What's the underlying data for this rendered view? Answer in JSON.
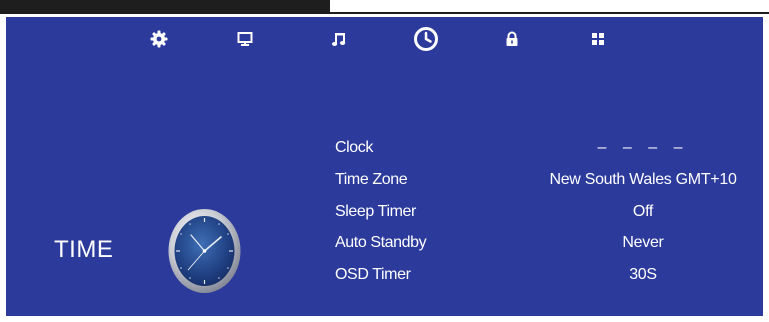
{
  "menu": {
    "items": [
      {
        "id": "settings",
        "icon": "gear-icon"
      },
      {
        "id": "picture",
        "icon": "monitor-icon"
      },
      {
        "id": "sound",
        "icon": "music-note-icon"
      },
      {
        "id": "time",
        "icon": "clock-icon",
        "selected": true
      },
      {
        "id": "lock",
        "icon": "lock-icon"
      },
      {
        "id": "apps",
        "icon": "grid-icon"
      }
    ]
  },
  "section": {
    "title": "TIME"
  },
  "settings": {
    "rows": [
      {
        "label": "Clock",
        "value": "– –    – –"
      },
      {
        "label": "Time Zone",
        "value": "New South Wales GMT+10"
      },
      {
        "label": "Sleep Timer",
        "value": "Off"
      },
      {
        "label": "Auto Standby",
        "value": "Never"
      },
      {
        "label": "OSD Timer",
        "value": "30S"
      }
    ]
  },
  "colors": {
    "panel_background": "#2b3a9b",
    "text": "#ffffff",
    "top_bar": "#1e1e1e"
  }
}
